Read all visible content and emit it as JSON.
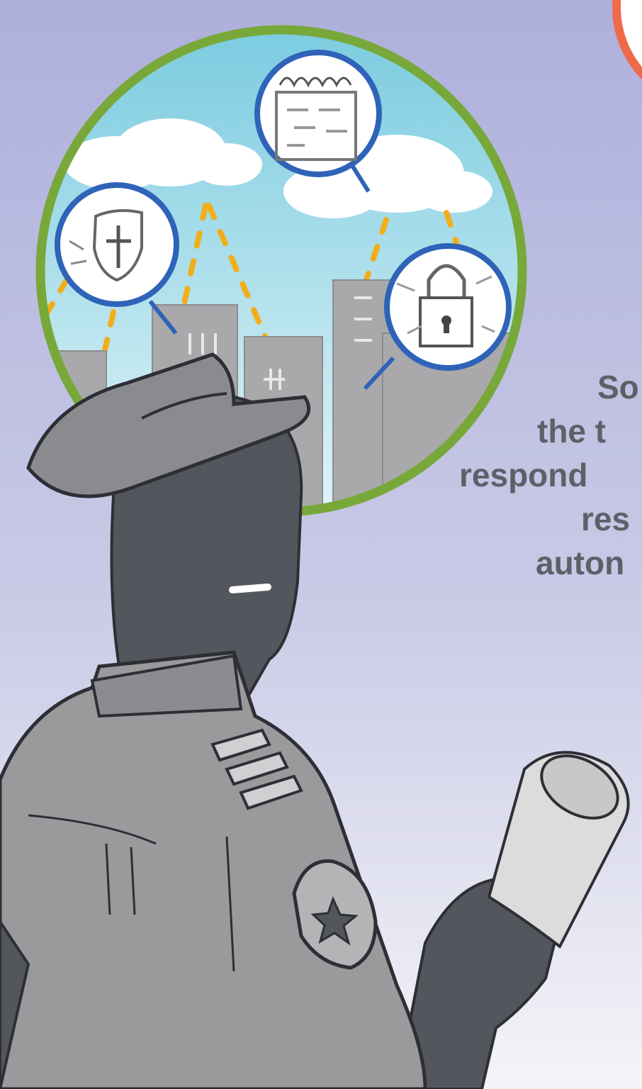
{
  "caption": {
    "lines": [
      "So",
      "the t",
      "respond",
      "res",
      "auton"
    ]
  },
  "colors": {
    "sky_top": "#aeb0dc",
    "sky_bottom": "#f4f4f8",
    "bubble_ring": "#78a83a",
    "bubble_sky": "#bfe6f0",
    "buildings": "#a9a9ab",
    "icon_ring": "#2e63b8",
    "dash_line": "#f2ae1a",
    "silhouette": "#54565e",
    "uniform": "#9a9a9c",
    "caption_text": "#5e6068",
    "partial_circle": "#ef6a4a"
  },
  "icons": [
    "shield-cross-icon",
    "barbed-wire-wall-icon",
    "padlock-chain-icon"
  ]
}
